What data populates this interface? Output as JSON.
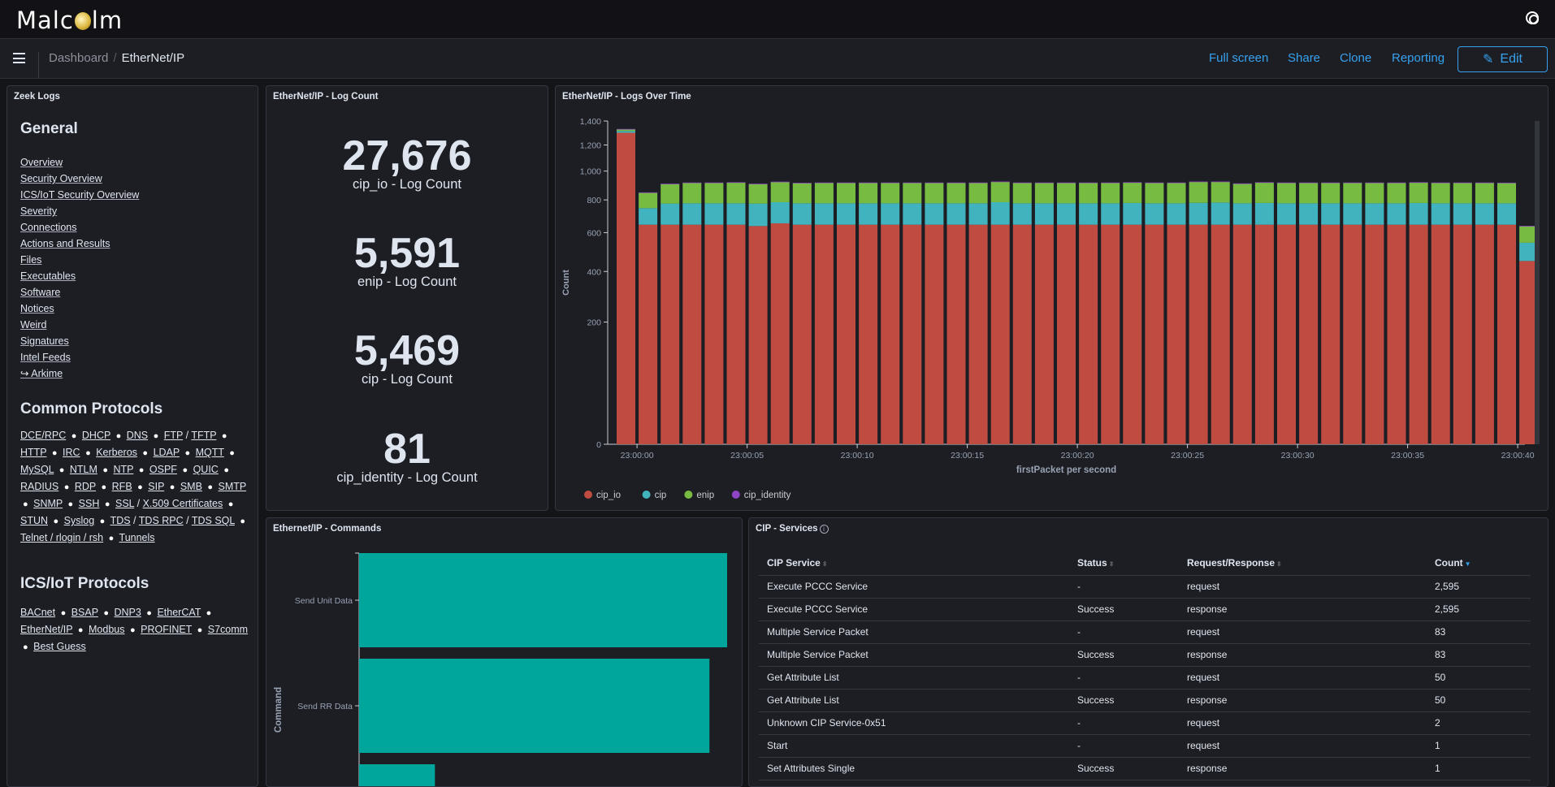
{
  "app": {
    "logo_text": "Malcolm"
  },
  "nav": {
    "breadcrumbs": [
      "Dashboard",
      "EtherNet/IP"
    ],
    "full_screen": "Full screen",
    "share": "Share",
    "clone": "Clone",
    "reporting": "Reporting",
    "edit": "Edit"
  },
  "zeek": {
    "title": "Zeek Logs",
    "general_heading": "General",
    "general_links": [
      "Overview",
      "Security Overview",
      "ICS/IoT Security Overview",
      "Severity",
      "Connections",
      "Actions and Results",
      "Files",
      "Executables",
      "Software",
      "Notices",
      "Weird",
      "Signatures",
      "Intel Feeds",
      "↪ Arkime"
    ],
    "common_heading": "Common Protocols",
    "common_groups": [
      [
        "DCE/RPC"
      ],
      [
        "DHCP"
      ],
      [
        "DNS"
      ],
      [
        "FTP",
        "TFTP"
      ],
      [
        "HTTP"
      ],
      [
        "IRC"
      ],
      [
        "Kerberos"
      ],
      [
        "LDAP"
      ],
      [
        "MQTT"
      ],
      [
        "MySQL"
      ],
      [
        "NTLM"
      ],
      [
        "NTP"
      ],
      [
        "OSPF"
      ],
      [
        "QUIC"
      ],
      [
        "RADIUS"
      ],
      [
        "RDP"
      ],
      [
        "RFB"
      ],
      [
        "SIP"
      ],
      [
        "SMB"
      ],
      [
        "SMTP"
      ],
      [
        "SNMP"
      ],
      [
        "SSH"
      ],
      [
        "SSL",
        "X.509 Certificates"
      ],
      [
        "STUN"
      ],
      [
        "Syslog"
      ],
      [
        "TDS",
        "TDS RPC",
        "TDS SQL"
      ],
      [
        "Telnet / rlogin / rsh"
      ],
      [
        "Tunnels"
      ]
    ],
    "ics_heading": "ICS/IoT Protocols",
    "ics_groups": [
      [
        "BACnet"
      ],
      [
        "BSAP"
      ],
      [
        "DNP3"
      ],
      [
        "EtherCAT"
      ],
      [
        "EtherNet/IP"
      ],
      [
        "Modbus"
      ],
      [
        "PROFINET"
      ],
      [
        "S7comm"
      ],
      [
        "Best Guess"
      ]
    ]
  },
  "log_count": {
    "title": "EtherNet/IP - Log Count",
    "metrics": [
      {
        "value": "27,676",
        "label": "cip_io - Log Count"
      },
      {
        "value": "5,591",
        "label": "enip - Log Count"
      },
      {
        "value": "5,469",
        "label": "cip - Log Count"
      },
      {
        "value": "81",
        "label": "cip_identity - Log Count"
      }
    ]
  },
  "chart_data": [
    {
      "type": "bar",
      "stacked": true,
      "title": "EtherNet/IP - Logs Over Time",
      "xlabel": "firstPacket per second",
      "ylabel": "Count",
      "y_scale": "sqrt",
      "ylim": [
        0,
        1400
      ],
      "yticks": [
        "0",
        "200",
        "400",
        "600",
        "800",
        "1,000",
        "1,200",
        "1,400"
      ],
      "ytick_values": [
        0,
        200,
        400,
        600,
        800,
        1000,
        1200,
        1400
      ],
      "xticks": [
        "23:00:00",
        "23:00:05",
        "23:00:10",
        "23:00:15",
        "23:00:20",
        "23:00:25",
        "23:00:30",
        "23:00:35",
        "23:00:40"
      ],
      "legend_position": "bottom-left",
      "x": [
        "22:59:59",
        "23:00:00",
        "23:00:01",
        "23:00:02",
        "23:00:03",
        "23:00:04",
        "23:00:05",
        "23:00:06",
        "23:00:07",
        "23:00:08",
        "23:00:09",
        "23:00:10",
        "23:00:11",
        "23:00:12",
        "23:00:13",
        "23:00:14",
        "23:00:15",
        "23:00:16",
        "23:00:17",
        "23:00:18",
        "23:00:19",
        "23:00:20",
        "23:00:21",
        "23:00:22",
        "23:00:23",
        "23:00:24",
        "23:00:25",
        "23:00:26",
        "23:00:27",
        "23:00:28",
        "23:00:29",
        "23:00:30",
        "23:00:31",
        "23:00:32",
        "23:00:33",
        "23:00:34",
        "23:00:35",
        "23:00:36",
        "23:00:37",
        "23:00:38",
        "23:00:39",
        "23:00:40"
      ],
      "series": [
        {
          "name": "cip_io",
          "color": "#c04b41",
          "values": [
            1300,
            646,
            646,
            646,
            646,
            646,
            638,
            654,
            646,
            646,
            646,
            646,
            646,
            646,
            646,
            646,
            646,
            646,
            646,
            646,
            646,
            646,
            646,
            646,
            646,
            646,
            646,
            646,
            646,
            646,
            646,
            646,
            646,
            646,
            646,
            646,
            646,
            646,
            646,
            646,
            646,
            450
          ]
        },
        {
          "name": "cip",
          "color": "#41b3bf",
          "values": [
            15,
            101,
            130,
            132,
            132,
            132,
            138,
            131,
            132,
            132,
            132,
            132,
            132,
            132,
            132,
            132,
            132,
            139,
            132,
            132,
            132,
            132,
            132,
            134,
            132,
            132,
            135,
            137,
            132,
            134,
            132,
            132,
            132,
            132,
            132,
            132,
            134,
            132,
            132,
            132,
            132,
            94
          ]
        },
        {
          "name": "enip",
          "color": "#77bc40",
          "values": [
            15,
            102,
            132,
            138,
            138,
            140,
            132,
            137,
            136,
            138,
            138,
            138,
            138,
            138,
            138,
            138,
            138,
            138,
            138,
            138,
            138,
            138,
            138,
            138,
            138,
            138,
            142,
            140,
            132,
            138,
            138,
            138,
            138,
            138,
            138,
            138,
            138,
            138,
            138,
            138,
            138,
            94
          ]
        },
        {
          "name": "cip_identity",
          "color": "#8e44c5",
          "values": [
            2,
            1,
            2,
            2,
            2,
            2,
            2,
            2,
            2,
            2,
            2,
            2,
            2,
            2,
            2,
            2,
            2,
            2,
            2,
            2,
            2,
            2,
            2,
            2,
            2,
            2,
            2,
            2,
            2,
            2,
            2,
            2,
            2,
            2,
            2,
            2,
            2,
            2,
            2,
            2,
            1,
            1
          ]
        }
      ]
    },
    {
      "type": "bar",
      "orientation": "horizontal",
      "title": "Ethernet/IP - Commands",
      "ylabel": "Command",
      "categories": [
        "Send Unit Data",
        "Send RR Data",
        ""
      ],
      "values": [
        1.0,
        0.952,
        0.206
      ],
      "color": "#00a69b"
    }
  ],
  "services": {
    "title": "CIP - Services",
    "columns": [
      "CIP Service",
      "Status",
      "Request/Response",
      "Count"
    ],
    "sorted_column": "Count",
    "rows": [
      [
        "Execute PCCC Service",
        "-",
        "request",
        "2,595"
      ],
      [
        "Execute PCCC Service",
        "Success",
        "response",
        "2,595"
      ],
      [
        "Multiple Service Packet",
        "-",
        "request",
        "83"
      ],
      [
        "Multiple Service Packet",
        "Success",
        "response",
        "83"
      ],
      [
        "Get Attribute List",
        "-",
        "request",
        "50"
      ],
      [
        "Get Attribute List",
        "Success",
        "response",
        "50"
      ],
      [
        "Unknown CIP Service-0x51",
        "-",
        "request",
        "2"
      ],
      [
        "Start",
        "-",
        "request",
        "1"
      ],
      [
        "Set Attributes Single",
        "Success",
        "response",
        "1"
      ]
    ]
  }
}
